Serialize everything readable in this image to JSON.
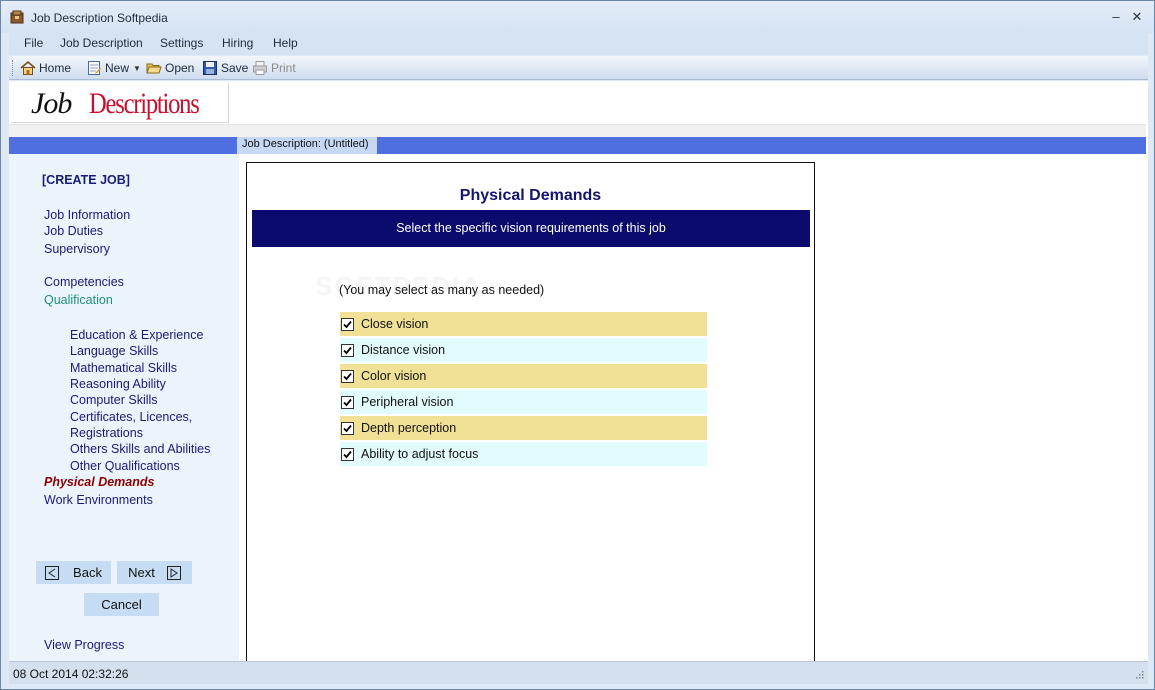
{
  "window": {
    "title": "Job Description Softpedia",
    "minimize_glyph": "–",
    "close_glyph": "✕"
  },
  "menu": {
    "items": [
      "File",
      "Job Description",
      "Settings",
      "Hiring",
      "Help"
    ]
  },
  "toolbar": {
    "home": "Home",
    "new": "New",
    "open": "Open",
    "save": "Save",
    "print": "Print"
  },
  "logo": {
    "job": "Job",
    "descriptions": "Descriptions"
  },
  "document_status": "Job Description: (Untitled)",
  "nav": {
    "create_job": "[CREATE JOB]",
    "job_information": "Job Information",
    "job_duties": "Job Duties",
    "supervisory": "Supervisory",
    "competencies": "Competencies",
    "qualification": "Qualification",
    "education_experience": "Education & Experience",
    "language_skills": "Language Skills",
    "mathematical_skills": "Mathematical Skills",
    "reasoning_ability": "Reasoning Ability",
    "computer_skills": "Computer Skills",
    "certificates_1": "Certificates, Licences,",
    "certificates_2": "Registrations",
    "others_skills": "Others Skills and Abilities",
    "other_qualifications": "Other Qualifications",
    "physical_demands": "Physical Demands",
    "work_environments": "Work Environments",
    "view_progress": "View Progress",
    "back": "Back",
    "next": "Next",
    "cancel": "Cancel"
  },
  "panel": {
    "title": "Physical Demands",
    "header": "Select the specific vision requirements of this job",
    "hint": "(You may select as many as needed)",
    "watermark": "SOFTPEDIA",
    "options": [
      {
        "label": "Close vision",
        "checked": true
      },
      {
        "label": "Distance vision",
        "checked": true
      },
      {
        "label": "Color vision",
        "checked": true
      },
      {
        "label": "Peripheral vision",
        "checked": true
      },
      {
        "label": "Depth perception",
        "checked": true
      },
      {
        "label": "Ability to adjust focus",
        "checked": true
      }
    ]
  },
  "statusbar": {
    "datetime": "08 Oct 2014 02:32:26"
  },
  "colors": {
    "accent_blue": "#4f6fe0",
    "header_navy": "#0b0b6e",
    "row_yellow": "#f0e196",
    "row_cyan": "#e2fbfc",
    "nav_active": "#1f8f7a",
    "nav_current": "#8b0000"
  }
}
